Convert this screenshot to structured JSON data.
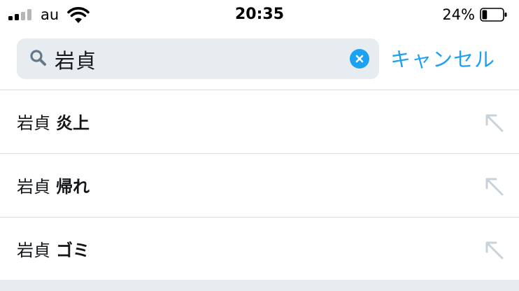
{
  "status_bar": {
    "carrier": "au",
    "time": "20:35",
    "battery_percent": "24%",
    "battery_level": 0.24,
    "signal_bars_filled": 2,
    "signal_bars_total": 4,
    "icons": [
      "signal-icon",
      "wifi-icon",
      "battery-icon"
    ]
  },
  "search": {
    "query": "岩貞",
    "cancel_label": "キャンセル",
    "icons": [
      "search-icon",
      "clear-icon"
    ]
  },
  "suggestions": [
    {
      "prefix": "岩貞",
      "completion": "炎上",
      "icon": "arrow-up-left-icon"
    },
    {
      "prefix": "岩貞",
      "completion": "帰れ",
      "icon": "arrow-up-left-icon"
    },
    {
      "prefix": "岩貞",
      "completion": "ゴミ",
      "icon": "arrow-up-left-icon"
    }
  ],
  "colors": {
    "accent": "#1da1f2",
    "search_background": "#e6ecf0",
    "divider": "#d8dde1",
    "arrow": "#c8d2da",
    "text": "#14171a"
  }
}
